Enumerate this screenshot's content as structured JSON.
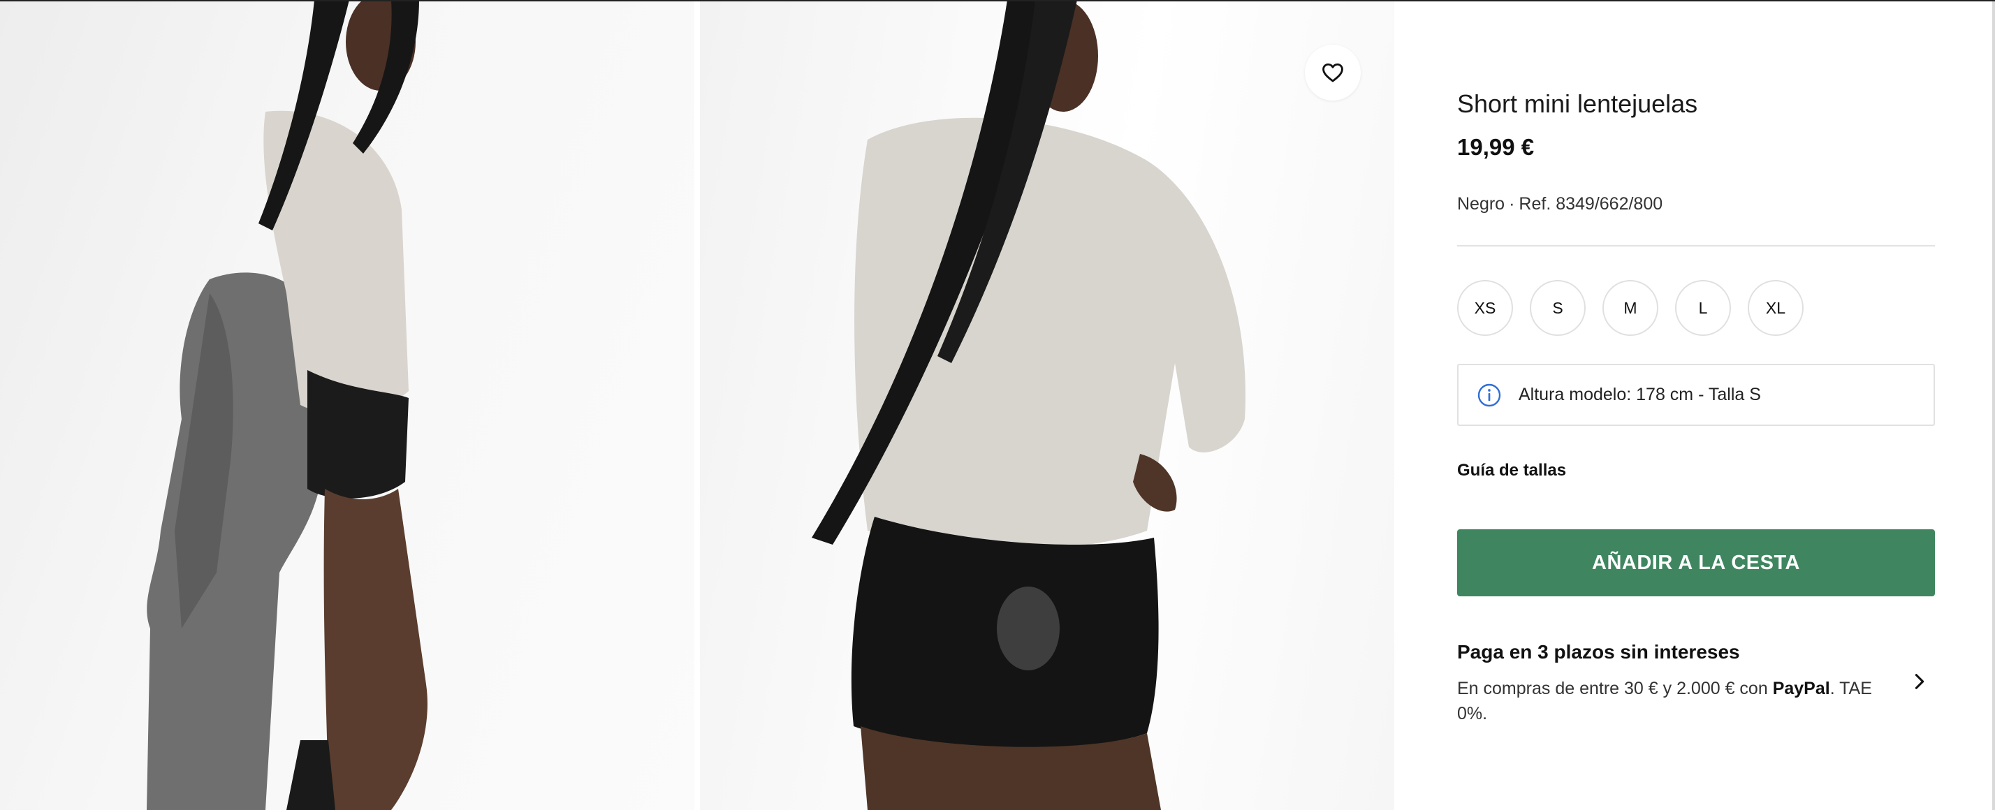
{
  "product": {
    "title": "Short mini lentejuelas",
    "price": "19,99 €",
    "color": "Negro",
    "separator": "·",
    "reference": "Ref. 8349/662/800"
  },
  "sizes": [
    "XS",
    "S",
    "M",
    "L",
    "XL"
  ],
  "model_info": {
    "icon": "info-icon",
    "text": "Altura modelo: 178 cm - Talla S"
  },
  "size_guide": "Guía de tallas",
  "add_to_cart": {
    "label": "AÑADIR A LA CESTA",
    "color": "#3f8660"
  },
  "payment": {
    "title": "Paga en 3 plazos sin intereses",
    "desc_before": "En compras de entre 30 € y 2.000 € con ",
    "desc_brand": "PayPal",
    "desc_after": ". TAE 0%."
  },
  "icons": {
    "wishlist": "heart-icon",
    "payment_arrow": "chevron-right-icon",
    "model_info": "info-icon"
  }
}
